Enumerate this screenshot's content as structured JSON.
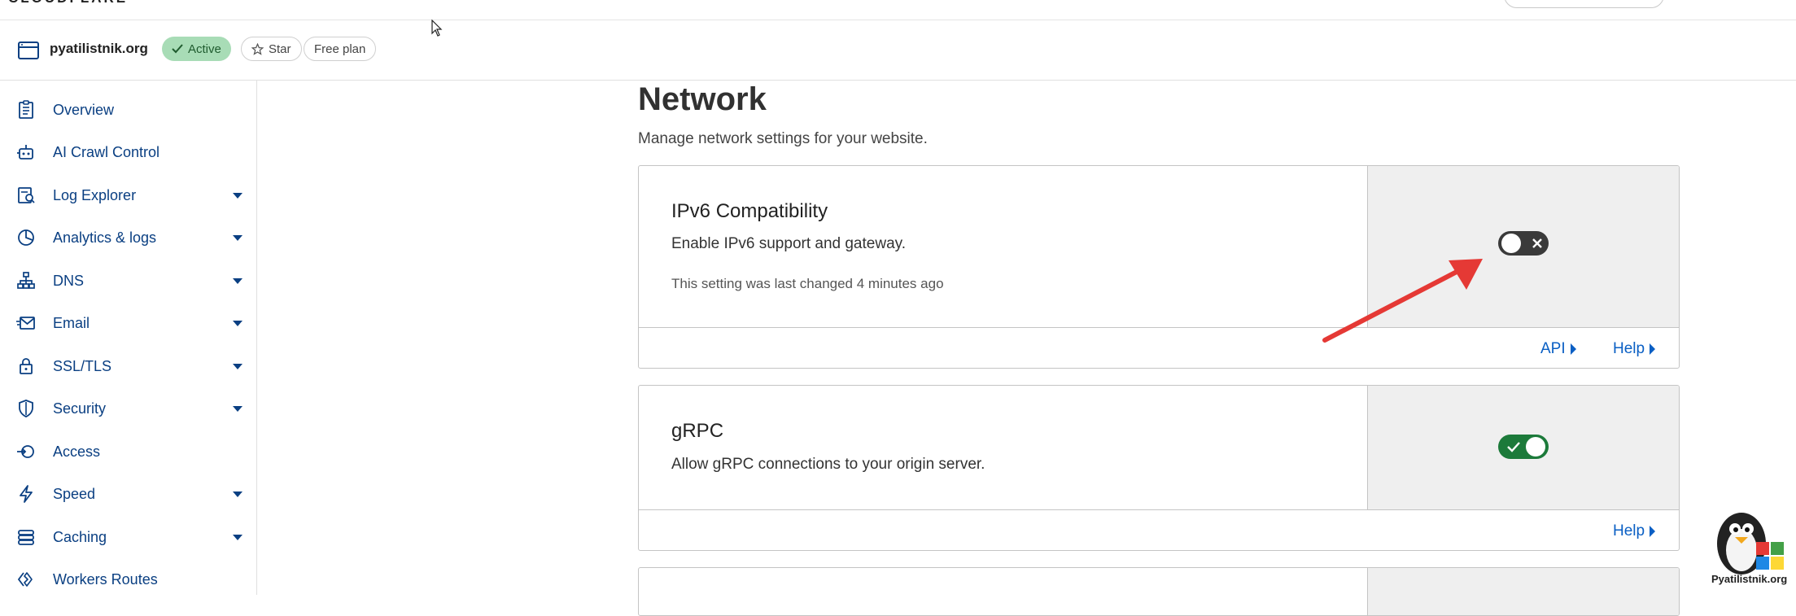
{
  "app": {
    "brand": "CLOUDFLARE"
  },
  "zone": {
    "name": "pyatilistnik.org",
    "status": "Active",
    "star_label": "Star",
    "plan": "Free plan"
  },
  "sidebar": {
    "items": [
      {
        "label": "Overview",
        "icon": "document-icon",
        "expandable": false
      },
      {
        "label": "AI Crawl Control",
        "icon": "robot-icon",
        "expandable": false
      },
      {
        "label": "Log Explorer",
        "icon": "log-explorer-icon",
        "expandable": true
      },
      {
        "label": "Analytics & logs",
        "icon": "pie-chart-icon",
        "expandable": true
      },
      {
        "label": "DNS",
        "icon": "network-tree-icon",
        "expandable": true
      },
      {
        "label": "Email",
        "icon": "envelope-icon",
        "expandable": true
      },
      {
        "label": "SSL/TLS",
        "icon": "lock-icon",
        "expandable": true
      },
      {
        "label": "Security",
        "icon": "shield-icon",
        "expandable": true
      },
      {
        "label": "Access",
        "icon": "access-icon",
        "expandable": false
      },
      {
        "label": "Speed",
        "icon": "lightning-icon",
        "expandable": true
      },
      {
        "label": "Caching",
        "icon": "stack-icon",
        "expandable": true
      },
      {
        "label": "Workers Routes",
        "icon": "workers-icon",
        "expandable": false
      }
    ]
  },
  "main": {
    "title": "Network",
    "subtitle": "Manage network settings for your website.",
    "cards": [
      {
        "title": "IPv6 Compatibility",
        "description": "Enable IPv6 support and gateway.",
        "meta": "This setting was last changed 4 minutes ago",
        "enabled": false,
        "links": [
          "API",
          "Help"
        ]
      },
      {
        "title": "gRPC",
        "description": "Allow gRPC connections to your origin server.",
        "enabled": true,
        "links": [
          "Help"
        ]
      }
    ]
  },
  "watermark": {
    "text": "Pyatilistnik.org"
  },
  "colors": {
    "nav_text": "#0a3f82",
    "link": "#0a5fc4",
    "active_badge_bg": "#a8dcb6",
    "toggle_on": "#1c7a3a",
    "toggle_off": "#3a3a3a",
    "annotation_arrow": "#e53935"
  }
}
